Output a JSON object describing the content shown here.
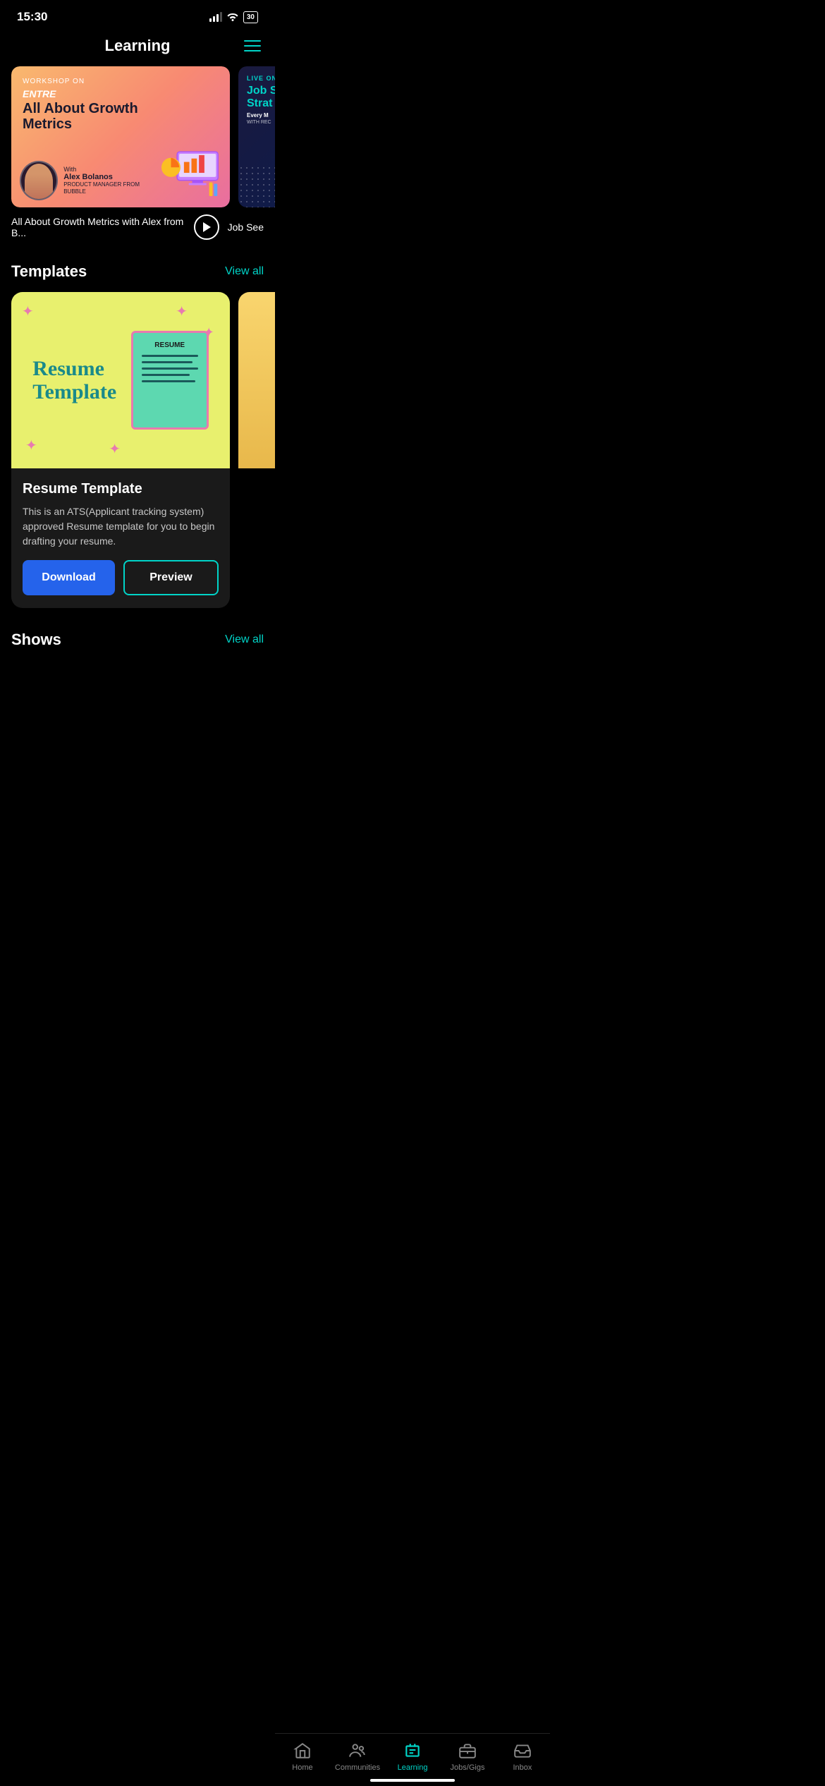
{
  "statusBar": {
    "time": "15:30",
    "battery": "30"
  },
  "header": {
    "title": "Learning",
    "menuIcon": "menu-icon"
  },
  "banners": [
    {
      "workshopLabel": "WORKSHOP ON",
      "brand": "ENTRE",
      "title": "All About Growth Metrics",
      "hostWith": "With",
      "hostName": "Alex Bolanos",
      "hostRole": "PRODUCT MANAGER\nFROM BUBBLE"
    },
    {
      "liveLabel": "LIVE ON",
      "titleLine1": "Job S",
      "titleLine2": "Strat",
      "subLabel": "Every M",
      "withRec": "WITH REC"
    }
  ],
  "captionRow": {
    "mainCaption": "All About Growth Metrics with Alex from B...",
    "secondaryCaption": "Job See",
    "playIcon": "play-icon"
  },
  "templates": {
    "sectionTitle": "Templates",
    "viewAll": "View all",
    "items": [
      {
        "name": "Resume Template",
        "description": "This is an ATS(Applicant tracking system) approved Resume template for you to begin drafting your resume.",
        "downloadLabel": "Download",
        "previewLabel": "Preview",
        "imageTitle": "Resume\nTemplate",
        "docTitle": "RESUME"
      }
    ]
  },
  "shows": {
    "sectionTitle": "Shows",
    "viewAll": "View all"
  },
  "bottomNav": {
    "items": [
      {
        "label": "Home",
        "icon": "home-icon",
        "active": false
      },
      {
        "label": "Communities",
        "icon": "communities-icon",
        "active": false
      },
      {
        "label": "Learning",
        "icon": "learning-icon",
        "active": true
      },
      {
        "label": "Jobs/Gigs",
        "icon": "jobs-icon",
        "active": false
      },
      {
        "label": "Inbox",
        "icon": "inbox-icon",
        "active": false
      }
    ]
  }
}
